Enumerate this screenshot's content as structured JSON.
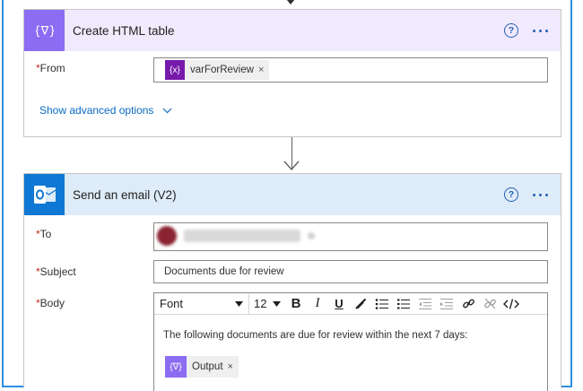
{
  "create_html_table": {
    "title": "Create HTML table",
    "help_label": "?",
    "from_label": "From",
    "required_mark": "*",
    "from_token": {
      "label": "varForReview",
      "icon": "{x}",
      "remove": "×"
    },
    "advanced_label": "Show advanced options"
  },
  "send_email": {
    "title": "Send an email (V2)",
    "help_label": "?",
    "to_label": "To",
    "subject_label": "Subject",
    "subject_value": "Documents due for review",
    "body_label": "Body",
    "toolbar": {
      "font": "Font",
      "size": "12",
      "bold": "B",
      "italic": "I",
      "underline": "U"
    },
    "body_text": "The following documents are due for review within the next 7 days:",
    "body_token": {
      "label": "Output",
      "icon": "{∇}",
      "remove": "×"
    }
  },
  "colors": {
    "accent_blue": "#2f8de4",
    "data_operation": "#8c6cf2",
    "outlook": "#0f78d4",
    "variable_token": "#7719aa"
  },
  "icons": [
    "data-operation-icon",
    "outlook-icon",
    "help-icon",
    "more-icon",
    "chevron-down-icon",
    "variable-icon",
    "avatar"
  ]
}
